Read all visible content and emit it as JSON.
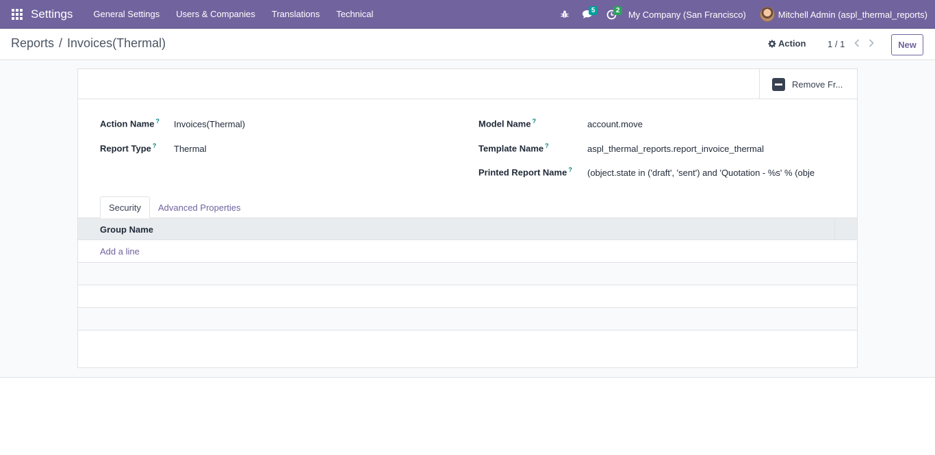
{
  "navbar": {
    "app_name": "Settings",
    "menu": [
      "General Settings",
      "Users & Companies",
      "Translations",
      "Technical"
    ],
    "messages_count": "5",
    "activities_count": "2",
    "company": "My Company (San Francisco)",
    "user": "Mitchell Admin (aspl_thermal_reports)"
  },
  "control_panel": {
    "breadcrumb_parent": "Reports",
    "breadcrumb_separator": "/",
    "breadcrumb_current": "Invoices(Thermal)",
    "action_label": "Action",
    "pager": "1 / 1",
    "new_label": "New"
  },
  "button_box": {
    "remove_label": "Remove Fr..."
  },
  "fields": {
    "action_name_label": "Action Name",
    "action_name_value": "Invoices(Thermal)",
    "report_type_label": "Report Type",
    "report_type_value": "Thermal",
    "model_name_label": "Model Name",
    "model_name_value": "account.move",
    "template_name_label": "Template Name",
    "template_name_value": "aspl_thermal_reports.report_invoice_thermal",
    "printed_name_label": "Printed Report Name",
    "printed_name_value": "(object.state in ('draft', 'sent') and 'Quotation - %s' % (obje",
    "help_mark": "?"
  },
  "tabs": [
    "Security",
    "Advanced Properties"
  ],
  "table": {
    "column": "Group Name",
    "add_line": "Add a line"
  },
  "colors": {
    "navbar": "#71639e",
    "accent": "#71639e",
    "help": "#017e84",
    "badge_messages": "#00a09d",
    "badge_activities": "#2fa15f"
  }
}
